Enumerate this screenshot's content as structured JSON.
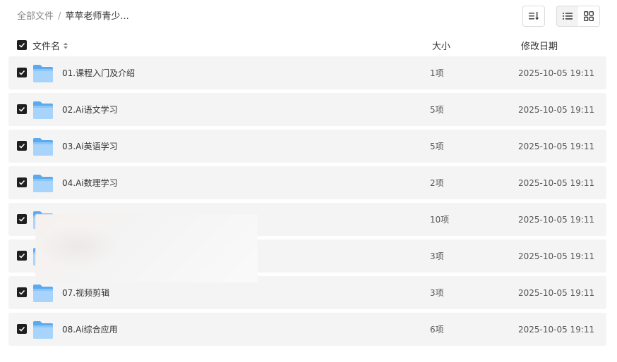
{
  "breadcrumb": {
    "root": "全部文件",
    "separator": "/",
    "current": "苹苹老师青少..."
  },
  "toolbar": {
    "sort_icon": "sort-icon",
    "list_view_icon": "list-view-icon",
    "grid_view_icon": "grid-view-icon",
    "active_view": "grid"
  },
  "table": {
    "columns": {
      "name": "文件名",
      "size": "大小",
      "date": "修改日期"
    },
    "rows": [
      {
        "name": "01.课程入门及介绍",
        "size": "1项",
        "date": "2025-10-05 19:11"
      },
      {
        "name": "02.Ai语文学习",
        "size": "5项",
        "date": "2025-10-05 19:11"
      },
      {
        "name": "03.Ai英语学习",
        "size": "5项",
        "date": "2025-10-05 19:11"
      },
      {
        "name": "04.Ai数理学习",
        "size": "2项",
        "date": "2025-10-05 19:11"
      },
      {
        "name": "",
        "size": "10项",
        "date": "2025-10-05 19:11"
      },
      {
        "name": "",
        "size": "3项",
        "date": "2025-10-05 19:11"
      },
      {
        "name": "07.视频剪辑",
        "size": "3项",
        "date": "2025-10-05 19:11"
      },
      {
        "name": "08.Ai综合应用",
        "size": "6项",
        "date": "2025-10-05 19:11"
      }
    ]
  },
  "colors": {
    "row_bg": "#f4f4f4",
    "checkbox": "#1f1f1f",
    "folder_light": "#a8d4fb",
    "folder_dark": "#5aaaf0"
  }
}
